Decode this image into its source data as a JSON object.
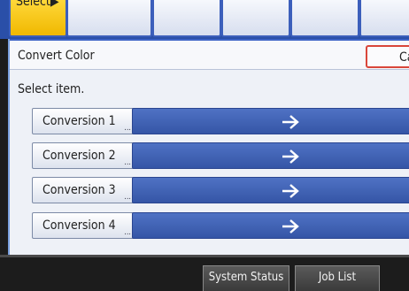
{
  "tabs": [
    {
      "label": "Select▶",
      "selected": true
    },
    {
      "label": "",
      "selected": false
    },
    {
      "label": "",
      "selected": false
    },
    {
      "label": "",
      "selected": false
    },
    {
      "label": "",
      "selected": false
    },
    {
      "label": "",
      "selected": false
    }
  ],
  "header": {
    "title": "Convert Color",
    "cancel_label": "Car"
  },
  "instruction": "Select item.",
  "conversions": [
    {
      "label": "Conversion 1",
      "arrow": "→"
    },
    {
      "label": "Conversion 2",
      "arrow": "→"
    },
    {
      "label": "Conversion 3",
      "arrow": "→"
    },
    {
      "label": "Conversion 4",
      "arrow": "→"
    }
  ],
  "ellipsis": "...",
  "footer": {
    "system_status": "System Status",
    "job_list": "Job List"
  },
  "colors": {
    "accent_blue": "#3555a6",
    "tab_selected": "#f0b800",
    "cancel_border": "#d9463a"
  },
  "icons": {
    "arrow": "right-arrow-icon"
  }
}
